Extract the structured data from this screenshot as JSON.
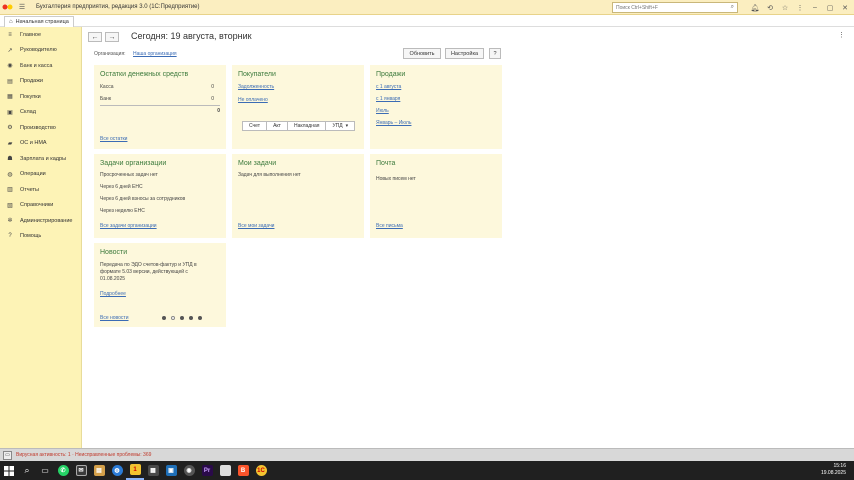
{
  "titlebar": {
    "title": "Бухгалтерия предприятия, редакция 3.0  (1С:Предприятие)",
    "search_placeholder": "Поиск Ctrl+Shift+F"
  },
  "tabs": [
    {
      "label": "Начальная страница"
    }
  ],
  "sidebar": {
    "items": [
      {
        "label": "Главное",
        "icon": "menu-icon",
        "glyph": "≡"
      },
      {
        "label": "Руководителю",
        "icon": "chart-line-icon",
        "glyph": "↗"
      },
      {
        "label": "Банк и касса",
        "icon": "coins-icon",
        "glyph": "◉"
      },
      {
        "label": "Продажи",
        "icon": "cart-icon",
        "glyph": "▤"
      },
      {
        "label": "Покупки",
        "icon": "basket-icon",
        "glyph": "▦"
      },
      {
        "label": "Склад",
        "icon": "warehouse-icon",
        "glyph": "▣"
      },
      {
        "label": "Производство",
        "icon": "factory-icon",
        "glyph": "⚙"
      },
      {
        "label": "ОС и НМА",
        "icon": "assets-icon",
        "glyph": "▰"
      },
      {
        "label": "Зарплата и кадры",
        "icon": "people-icon",
        "glyph": "☗"
      },
      {
        "label": "Операции",
        "icon": "operations-icon",
        "glyph": "◍"
      },
      {
        "label": "Отчеты",
        "icon": "reports-icon",
        "glyph": "▥"
      },
      {
        "label": "Справочники",
        "icon": "book-icon",
        "glyph": "▧"
      },
      {
        "label": "Администрирование",
        "icon": "gear-icon",
        "glyph": "✲"
      },
      {
        "label": "Помощь",
        "icon": "help-icon",
        "glyph": "?"
      }
    ]
  },
  "main": {
    "title": "Сегодня: 19 августа, вторник",
    "org_label": "Организация:",
    "org_value": "Наша организация",
    "refresh_label": "Обновить",
    "settings_label": "Настройка",
    "help_label": "?"
  },
  "panels": {
    "cash": {
      "title": "Остатки денежных средств",
      "rows": [
        {
          "label": "Касса",
          "value": "0"
        },
        {
          "label": "Банк",
          "value": "0"
        }
      ],
      "total": "0",
      "link": "Все остатки"
    },
    "buyers": {
      "title": "Покупатели",
      "links": [
        "Задолженность",
        "Не оплачено"
      ],
      "doc_buttons": [
        "Счет",
        "Акт",
        "Накладная",
        "УПД"
      ]
    },
    "sales": {
      "title": "Продажи",
      "links": [
        "с 1 августа",
        "с 1 января",
        "Июль",
        "Январь – Июль"
      ]
    },
    "tasks": {
      "title": "Задачи организации",
      "items": [
        "Просроченных задач нет",
        "Через 6 дней ЕНС",
        "Через 6 дней взносы за сотрудников",
        "Через неделю ЕНС"
      ],
      "link": "Все задачи организации"
    },
    "mytasks": {
      "title": "Мои задачи",
      "text": "Задач для выполнения нет",
      "link": "Все мои задачи"
    },
    "mail": {
      "title": "Почта",
      "text": "Новых писем нет",
      "link": "Все письма"
    },
    "news": {
      "title": "Новости",
      "lines": [
        "Передача по ЭДО счетов-фактур и УПД в",
        "формате 5.03 версии, действующей с",
        "01.08.2025"
      ],
      "more": "Подробнее",
      "link": "Все новости"
    }
  },
  "statusbar": {
    "text": "Вирусная активность: 1 · Неисправленные проблемы: 369"
  },
  "taskbar": {
    "time": "15:16",
    "date": "19.08.2025"
  },
  "colors": {
    "accent_green": "#3c7a3c",
    "link_blue": "#3b6cb5",
    "sidebar_bg": "#fdf3b6",
    "panel_bg": "#fdf8dc"
  }
}
